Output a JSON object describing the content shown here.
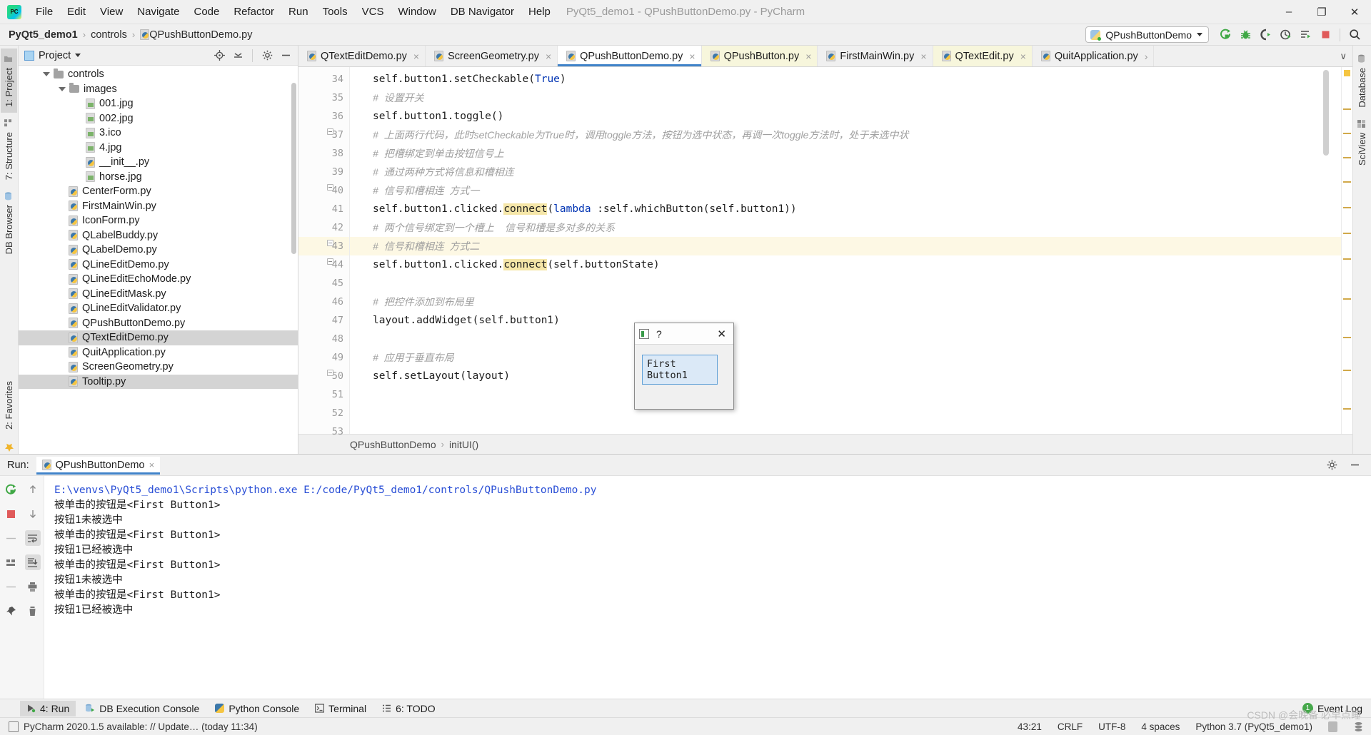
{
  "titlebar": {
    "logo": "pycharm-logo",
    "menus": [
      "File",
      "Edit",
      "View",
      "Navigate",
      "Code",
      "Refactor",
      "Run",
      "Tools",
      "VCS",
      "Window",
      "DB Navigator",
      "Help"
    ],
    "window_title": "PyQt5_demo1 - QPushButtonDemo.py - PyCharm",
    "minimize": "–",
    "maximize": "❐",
    "close": "✕"
  },
  "navbar": {
    "crumbs": [
      "PyQt5_demo1",
      "controls",
      "QPushButtonDemo.py"
    ],
    "separator": "›",
    "run_config": "QPushButtonDemo",
    "toolbar_icons": [
      "run-icon",
      "debug-icon",
      "run-coverage-icon",
      "profile-icon",
      "run-with-console-icon",
      "stop-icon",
      "search-everywhere-icon"
    ]
  },
  "left_strip": {
    "tabs": [
      {
        "label": "1: Project",
        "icon": "project-folder-icon",
        "active": true
      },
      {
        "label": "7: Structure",
        "icon": "structure-icon",
        "active": false
      },
      {
        "label": "DB Browser",
        "icon": "db-browser-icon",
        "active": false
      }
    ],
    "bottom": [
      {
        "label": "2: Favorites",
        "icon": "star-icon"
      }
    ]
  },
  "right_strip": {
    "tabs": [
      {
        "label": "Database",
        "icon": "database-icon"
      },
      {
        "label": "SciView",
        "icon": "sciview-icon"
      }
    ]
  },
  "project_panel": {
    "title": "Project",
    "header_icons": [
      "locate-icon",
      "collapse-all-icon",
      "settings-gear-icon",
      "hide-icon"
    ],
    "tree": [
      {
        "label": "controls",
        "type": "folder",
        "indent": 1,
        "expanded": true,
        "selected": false
      },
      {
        "label": "images",
        "type": "folder",
        "indent": 2,
        "expanded": true,
        "selected": false
      },
      {
        "label": "001.jpg",
        "type": "image",
        "indent": 4,
        "selected": false
      },
      {
        "label": "002.jpg",
        "type": "image",
        "indent": 4,
        "selected": false
      },
      {
        "label": "3.ico",
        "type": "image",
        "indent": 4,
        "selected": false
      },
      {
        "label": "4.jpg",
        "type": "image",
        "indent": 4,
        "selected": false
      },
      {
        "label": "__init__.py",
        "type": "python",
        "indent": 4,
        "selected": false
      },
      {
        "label": "horse.jpg",
        "type": "image",
        "indent": 4,
        "selected": false
      },
      {
        "label": "CenterForm.py",
        "type": "python",
        "indent": 3,
        "selected": false
      },
      {
        "label": "FirstMainWin.py",
        "type": "python",
        "indent": 3,
        "selected": false
      },
      {
        "label": "IconForm.py",
        "type": "python",
        "indent": 3,
        "selected": false
      },
      {
        "label": "QLabelBuddy.py",
        "type": "python",
        "indent": 3,
        "selected": false
      },
      {
        "label": "QLabelDemo.py",
        "type": "python",
        "indent": 3,
        "selected": false
      },
      {
        "label": "QLineEditDemo.py",
        "type": "python",
        "indent": 3,
        "selected": false
      },
      {
        "label": "QLineEditEchoMode.py",
        "type": "python",
        "indent": 3,
        "selected": false
      },
      {
        "label": "QLineEditMask.py",
        "type": "python",
        "indent": 3,
        "selected": false
      },
      {
        "label": "QLineEditValidator.py",
        "type": "python",
        "indent": 3,
        "selected": false
      },
      {
        "label": "QPushButtonDemo.py",
        "type": "python",
        "indent": 3,
        "selected": false
      },
      {
        "label": "QTextEditDemo.py",
        "type": "python",
        "indent": 3,
        "selected": true
      },
      {
        "label": "QuitApplication.py",
        "type": "python",
        "indent": 3,
        "selected": false
      },
      {
        "label": "ScreenGeometry.py",
        "type": "python",
        "indent": 3,
        "selected": false
      },
      {
        "label": "Tooltip.py",
        "type": "python",
        "indent": 3,
        "selected": false
      }
    ]
  },
  "editor": {
    "tabs": [
      {
        "label": "QTextEditDemo.py",
        "state": "normal",
        "active": false
      },
      {
        "label": "ScreenGeometry.py",
        "state": "normal",
        "active": false
      },
      {
        "label": "QPushButtonDemo.py",
        "state": "active",
        "active": true
      },
      {
        "label": "QPushButton.py",
        "state": "modified",
        "active": false
      },
      {
        "label": "FirstMainWin.py",
        "state": "normal",
        "active": false
      },
      {
        "label": "QTextEdit.py",
        "state": "modified",
        "active": false
      },
      {
        "label": "QuitApplication.py",
        "state": "normal",
        "active": false
      }
    ],
    "tab_close_glyph": "×",
    "tab_overflow_glyph": "›",
    "tab_list_glyph": "∨",
    "lines": [
      {
        "n": 34,
        "fold": false,
        "hl": false,
        "clipped": true,
        "parts": [
          {
            "t": "self.button1.setCheckable(",
            "c": "txt"
          },
          {
            "t": "True",
            "c": "kw"
          },
          {
            "t": ")",
            "c": "txt"
          }
        ]
      },
      {
        "n": 35,
        "fold": false,
        "hl": false,
        "parts": [
          {
            "t": "#  设置开关",
            "c": "cm"
          }
        ]
      },
      {
        "n": 36,
        "fold": false,
        "hl": false,
        "parts": [
          {
            "t": "self.button1.toggle()",
            "c": "txt"
          }
        ]
      },
      {
        "n": 37,
        "fold": true,
        "hl": false,
        "parts": [
          {
            "t": "#  上面两行代码，此时setCheckable为True时，调用toggle方法，按钮为选中状态，再调一次toggle方法时，处于未选中状",
            "c": "cm"
          }
        ]
      },
      {
        "n": 38,
        "fold": false,
        "hl": false,
        "parts": [
          {
            "t": "#  把槽绑定到单击按钮信号上",
            "c": "cm"
          }
        ]
      },
      {
        "n": 39,
        "fold": false,
        "hl": false,
        "parts": [
          {
            "t": "#  通过两种方式将信息和槽相连",
            "c": "cm"
          }
        ]
      },
      {
        "n": 40,
        "fold": true,
        "hl": false,
        "parts": [
          {
            "t": "#  信号和槽相连  方式一",
            "c": "cm"
          }
        ]
      },
      {
        "n": 41,
        "fold": false,
        "hl": false,
        "parts": [
          {
            "t": "self.button1.clicked.",
            "c": "txt"
          },
          {
            "t": "connect",
            "c": "hi"
          },
          {
            "t": "(",
            "c": "txt"
          },
          {
            "t": "lambda",
            "c": "kw"
          },
          {
            "t": " :self.whichButton(self.button1))",
            "c": "txt"
          }
        ]
      },
      {
        "n": 42,
        "fold": true,
        "hl": false,
        "parts": [
          {
            "t": "#  两个信号绑定到一个槽上    信号和槽是多对多的关系",
            "c": "cm"
          }
        ]
      },
      {
        "n": 43,
        "fold": true,
        "hl": true,
        "parts": [
          {
            "t": "#  信号和槽相连  方式二",
            "c": "cm"
          }
        ]
      },
      {
        "n": 44,
        "fold": false,
        "hl": false,
        "parts": [
          {
            "t": "self.button1.clicked.",
            "c": "txt"
          },
          {
            "t": "connect",
            "c": "hi"
          },
          {
            "t": "(self.buttonState)",
            "c": "txt"
          }
        ]
      },
      {
        "n": 45,
        "fold": false,
        "hl": false,
        "parts": []
      },
      {
        "n": 46,
        "fold": false,
        "hl": false,
        "parts": [
          {
            "t": "#  把控件添加到布局里",
            "c": "cm"
          }
        ]
      },
      {
        "n": 47,
        "fold": false,
        "hl": false,
        "parts": [
          {
            "t": "layout.addWidget(self.button1)",
            "c": "txt"
          }
        ]
      },
      {
        "n": 48,
        "fold": false,
        "hl": false,
        "parts": []
      },
      {
        "n": 49,
        "fold": false,
        "hl": false,
        "parts": [
          {
            "t": "#  应用于垂直布局",
            "c": "cm"
          }
        ]
      },
      {
        "n": 50,
        "fold": true,
        "hl": false,
        "parts": [
          {
            "t": "self.setLayout(layout)",
            "c": "txt"
          }
        ]
      },
      {
        "n": 51,
        "fold": false,
        "hl": false,
        "parts": []
      },
      {
        "n": 52,
        "fold": false,
        "hl": false,
        "parts": []
      },
      {
        "n": 53,
        "fold": false,
        "hl": false,
        "parts": []
      }
    ],
    "breadcrumb": [
      "QPushButtonDemo",
      "initUI()"
    ],
    "breadcrumb_sep": "›"
  },
  "qt_dialog": {
    "icon": "qt-app-icon",
    "help_glyph": "?",
    "close_glyph": "✕",
    "button_label": "First Button1"
  },
  "run_window": {
    "label": "Run:",
    "tab_name": "QPushButtonDemo",
    "tab_close": "×",
    "side_icons": [
      "rerun-icon",
      "stop-icon",
      "scroll-up-icon",
      "scroll-down-icon",
      "grid-icon",
      "soft-wrap-icon",
      "scroll-to-end-icon",
      "pin-icon",
      "print-icon",
      "clear-all-icon"
    ],
    "header_right_icons": [
      "settings-gear-icon",
      "hide-icon"
    ],
    "output": [
      {
        "text": "E:\\venvs\\PyQt5_demo1\\Scripts\\python.exe E:/code/PyQt5_demo1/controls/QPushButtonDemo.py",
        "kind": "cmd"
      },
      {
        "text": "被单击的按钮是<First Button1>",
        "kind": "out"
      },
      {
        "text": "按钮1未被选中",
        "kind": "out"
      },
      {
        "text": "被单击的按钮是<First Button1>",
        "kind": "out"
      },
      {
        "text": "按钮1已经被选中",
        "kind": "out"
      },
      {
        "text": "被单击的按钮是<First Button1>",
        "kind": "out"
      },
      {
        "text": "按钮1未被选中",
        "kind": "out"
      },
      {
        "text": "被单击的按钮是<First Button1>",
        "kind": "out"
      },
      {
        "text": "按钮1已经被选中",
        "kind": "out"
      }
    ]
  },
  "toolwindow_bar": {
    "items": [
      {
        "label": "4: Run",
        "icon": "run-icon",
        "active": true
      },
      {
        "label": "DB Execution Console",
        "icon": "db-console-icon",
        "active": false
      },
      {
        "label": "Python Console",
        "icon": "python-icon",
        "active": false
      },
      {
        "label": "Terminal",
        "icon": "terminal-icon",
        "active": false
      },
      {
        "label": "6: TODO",
        "icon": "todo-icon",
        "active": false
      }
    ],
    "event_log": "Event Log",
    "event_count": "1"
  },
  "statusbar": {
    "message": "PyCharm 2020.1.5 available: // Update… (today 11:34)",
    "caret": "43:21",
    "line_sep": "CRLF",
    "encoding": "UTF-8",
    "indent": "4 spaces",
    "interpreter": "Python 3.7 (PyQt5_demo1)",
    "icons": [
      "lock-icon",
      "db-status-icon"
    ]
  },
  "watermark": "CSDN @会晚备 必早点睡",
  "colors": {
    "accent_blue": "#4083c9",
    "modified_tab": "#f7f6dc",
    "selection_gray": "#d4d4d4",
    "comment_gray": "#a0a0a0",
    "keyword_blue": "#0033b3",
    "highlight_yellow": "#f5e6a8",
    "console_blue": "#2a4fd6",
    "green_run": "#3fa845",
    "red_stop": "#e05a5a"
  }
}
